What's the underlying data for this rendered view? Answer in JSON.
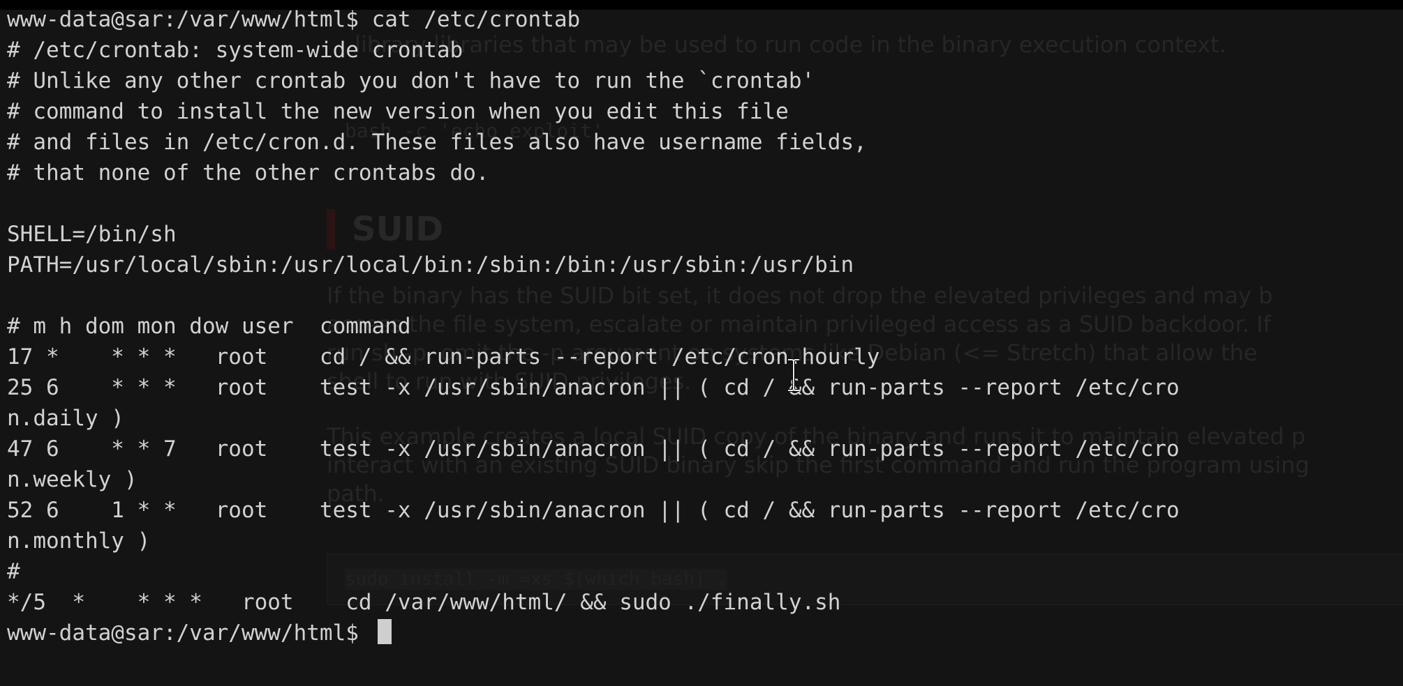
{
  "background_page": {
    "heading": "SUID",
    "lines": [
      "library libraries that may be used to run code in the binary execution context.",
      "bash -c 'echo exploit'",
      "If the binary has the SUID bit set, it does not drop the elevated privileges and may b",
      "access the file system, escalate or maintain privileged access as a SUID backdoor. If",
      "run sh -p, omit the -p argument on systems like Debian (<= Stretch) that allow the",
      "shell to run with SUID privileges.",
      "This example creates a local SUID copy of the binary and runs it to maintain elevated p",
      "interact with an existing SUID binary skip the first command and run the program using",
      "path."
    ],
    "code_snippet": "sudo install -m =xs $(which bash) ."
  },
  "terminal": {
    "lines": [
      "www-data@sar:/var/www/html$ cat /etc/crontab",
      "# /etc/crontab: system-wide crontab",
      "# Unlike any other crontab you don't have to run the `crontab'",
      "# command to install the new version when you edit this file",
      "# and files in /etc/cron.d. These files also have username fields,",
      "# that none of the other crontabs do.",
      "",
      "SHELL=/bin/sh",
      "PATH=/usr/local/sbin:/usr/local/bin:/sbin:/bin:/usr/sbin:/usr/bin",
      "",
      "# m h dom mon dow user  command",
      "17 *    * * *   root    cd / && run-parts --report /etc/cron.hourly",
      "25 6    * * *   root    test -x /usr/sbin/anacron || ( cd / && run-parts --report /etc/cro",
      "n.daily )",
      "47 6    * * 7   root    test -x /usr/sbin/anacron || ( cd / && run-parts --report /etc/cro",
      "n.weekly )",
      "52 6    1 * *   root    test -x /usr/sbin/anacron || ( cd / && run-parts --report /etc/cro",
      "n.monthly )",
      "#",
      "*/5  *    * * *   root    cd /var/www/html/ && sudo ./finally.sh"
    ],
    "prompt": "www-data@sar:/var/www/html$ "
  },
  "colors": {
    "terminal_bg": "#141414",
    "terminal_text": "#d2d2d2",
    "cursor": "#cfcfcf",
    "faint_page_text": "#262626"
  },
  "icons": {
    "mouse_pointer": "text-cursor-ibeam-icon"
  }
}
